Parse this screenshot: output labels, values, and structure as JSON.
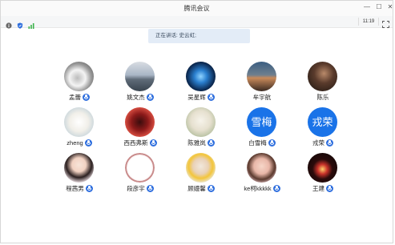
{
  "window": {
    "title": "腾讯会议"
  },
  "toolbar": {
    "clock": "11:19"
  },
  "banner": {
    "speaking": "正在讲话: 史云虹;"
  },
  "participants": [
    {
      "name": "孟蕾",
      "avatar": "photo"
    },
    {
      "name": "姚文杰",
      "avatar": "photo"
    },
    {
      "name": "吴星辉",
      "avatar": "photo"
    },
    {
      "name": "牟宇航",
      "avatar": "photo"
    },
    {
      "name": "陈乐",
      "avatar": "photo"
    },
    {
      "name": "zheng",
      "avatar": "photo"
    },
    {
      "name": "西西弗斯",
      "avatar": "photo"
    },
    {
      "name": "陈雅岚",
      "avatar": "photo"
    },
    {
      "name": "白雪梅",
      "avatar_text": "雪梅"
    },
    {
      "name": "戎荣",
      "avatar_text": "戎荣"
    },
    {
      "name": "程茜男",
      "avatar": "photo"
    },
    {
      "name": "段彦宇",
      "avatar": "photo"
    },
    {
      "name": "顾嫚馨",
      "avatar": "photo"
    },
    {
      "name": "ke柯kkkkk",
      "avatar": "photo"
    },
    {
      "name": "王建",
      "avatar": "photo"
    }
  ],
  "colors": {
    "accent": "#2f6fde",
    "avatar_text_bg": "#1a73e8",
    "banner_bg": "#e3ecf7"
  }
}
